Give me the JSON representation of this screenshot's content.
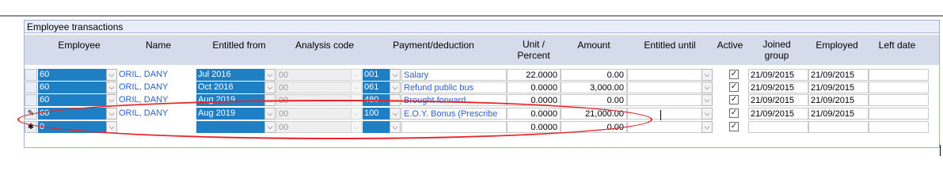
{
  "panel": {
    "title": "Employee transactions"
  },
  "columns": {
    "employee": "Employee",
    "name": "Name",
    "entitled_from": "Entitled from",
    "analysis_code": "Analysis code",
    "payment_deduction": "Payment/deduction",
    "unit_percent": "Unit /\nPercent",
    "amount": "Amount",
    "entitled_until": "Entitled until",
    "active": "Active",
    "joined_group": "Joined\ngroup",
    "employed": "Employed",
    "left_date": "Left date"
  },
  "rows": [
    {
      "employee": "60",
      "name": "ORIL, DANY",
      "entitled_from": "Jul 2016",
      "analysis_code": "00",
      "pay_code": "001",
      "pay_name": "Salary",
      "unit": "22.0000",
      "amount": "0.00",
      "entitled_until": "",
      "active": "✓",
      "joined_group": "21/09/2015",
      "employed": "21/09/2015",
      "left_date": ""
    },
    {
      "employee": "60",
      "name": "ORIL, DANY",
      "entitled_from": "Oct 2016",
      "analysis_code": "00",
      "pay_code": "061",
      "pay_name": "Refund public bus",
      "unit": "0.0000",
      "amount": "3,000.00",
      "entitled_until": "",
      "active": "✓",
      "joined_group": "21/09/2015",
      "employed": "21/09/2015",
      "left_date": ""
    },
    {
      "employee": "60",
      "name": "ORIL, DANY",
      "entitled_from": "Aug 2019",
      "analysis_code": "00",
      "pay_code": "480",
      "pay_name": "Brought forward",
      "unit": "0.0000",
      "amount": "0.00",
      "entitled_until": "",
      "active": "✓",
      "joined_group": "21/09/2015",
      "employed": "21/09/2015",
      "left_date": ""
    },
    {
      "employee": "60",
      "name": "ORIL, DANY",
      "entitled_from": "Aug 2019",
      "analysis_code": "00",
      "pay_code": "100",
      "pay_name": "E.O.Y. Bonus (Prescribe",
      "unit": "0.0000",
      "amount": "21,000.00",
      "entitled_until": "",
      "active": "✓",
      "joined_group": "21/09/2015",
      "employed": "21/09/2015",
      "left_date": "",
      "selector": "✎"
    },
    {
      "employee": "0",
      "name": "",
      "entitled_from": "",
      "analysis_code": "00",
      "pay_code": "",
      "pay_name": "",
      "unit": "0.0000",
      "amount": "0.00",
      "entitled_until": "",
      "active": "✓",
      "joined_group": "",
      "employed": "",
      "left_date": "",
      "selector": "✱"
    }
  ],
  "icons": {
    "dropdown": "chevron-down-icon",
    "row_edit": "pencil-icon",
    "new_row": "asterisk-icon",
    "checkbox": "checkmark-icon"
  },
  "colors": {
    "selected_cell": "#1f7fc4",
    "header_bg": "#d4dceb",
    "highlight_ring": "#e8242a",
    "link_text": "#2e5fcc"
  }
}
